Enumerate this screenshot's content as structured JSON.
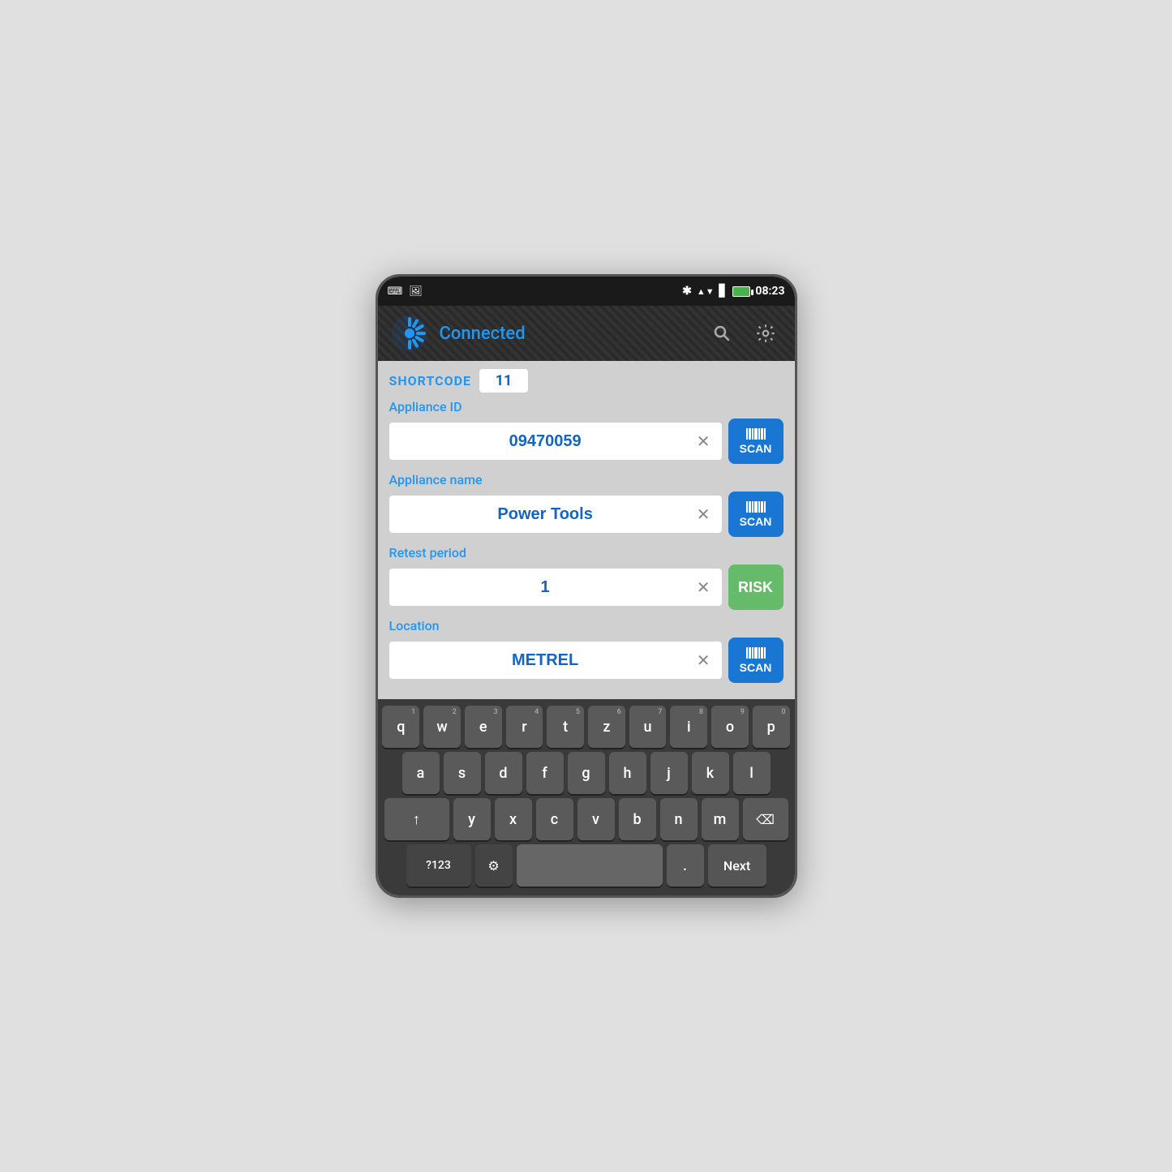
{
  "status_bar": {
    "time": "08:23",
    "icons": [
      "keyboard",
      "image",
      "bluetooth",
      "data",
      "signal",
      "battery"
    ]
  },
  "header": {
    "title": "Connected",
    "search_icon": "🔍",
    "settings_icon": "⚙"
  },
  "form": {
    "shortcode_label": "SHORTCODE",
    "shortcode_value": "11",
    "appliance_id_label": "Appliance ID",
    "appliance_id_value": "09470059",
    "appliance_name_label": "Appliance name",
    "appliance_name_value": "Power Tools",
    "retest_period_label": "Retest period",
    "retest_period_value": "1",
    "location_label": "Location",
    "location_value": "METREL",
    "scan_label": "SCAN",
    "risk_label": "RISK"
  },
  "keyboard": {
    "rows": [
      [
        "q",
        "w",
        "e",
        "r",
        "t",
        "z",
        "u",
        "i",
        "o",
        "p"
      ],
      [
        "a",
        "s",
        "d",
        "f",
        "g",
        "h",
        "j",
        "k",
        "l"
      ],
      [
        "↑",
        "y",
        "x",
        "c",
        "v",
        "b",
        "n",
        "m",
        "⌫"
      ]
    ],
    "numbers": [
      "1",
      "2",
      "3",
      "4",
      "5",
      "6",
      "7",
      "8",
      "9",
      "0"
    ],
    "bottom": [
      "?123",
      "⚙",
      "",
      ".",
      "Next"
    ]
  }
}
